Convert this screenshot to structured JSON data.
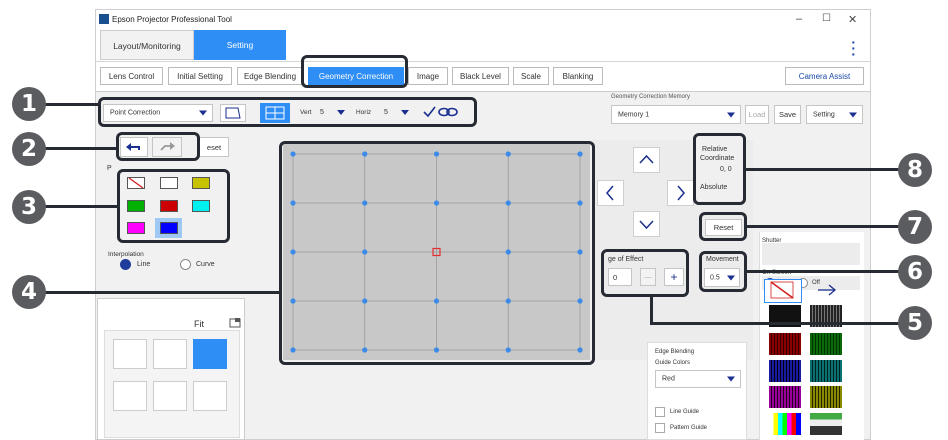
{
  "window": {
    "title": "Epson Projector Professional Tool"
  },
  "main_tabs": [
    {
      "label": "Layout/Monitoring"
    },
    {
      "label": "Setting"
    }
  ],
  "sub_tabs": [
    {
      "label": "Lens Control"
    },
    {
      "label": "Initial Setting"
    },
    {
      "label": "Edge Blending"
    },
    {
      "label": "Geometry Correction"
    },
    {
      "label": "Image"
    },
    {
      "label": "Black Level"
    },
    {
      "label": "Scale"
    },
    {
      "label": "Blanking"
    }
  ],
  "camera_assist_label": "Camera Assist",
  "correction_toolbar": {
    "mode_value": "Point Correction",
    "vert_label": "Vert",
    "vert_value": "5",
    "horiz_label": "Horiz",
    "horiz_value": "5"
  },
  "memory": {
    "label": "Geometry Correction Memory",
    "value": "Memory 1",
    "load_label": "Load",
    "save_label": "Save",
    "setting_label": "Setting"
  },
  "undo_panel": {
    "reset_label": "eset"
  },
  "palette_label": "P",
  "pattern_colors": [
    "#ffffff",
    "#ffffff",
    "#c8c300",
    "#00b000",
    "#cc0000",
    "#00f0f0",
    "#ff00ff",
    "#0000ff"
  ],
  "interpolation": {
    "label": "Interpolation",
    "line_label": "Line",
    "curve_label": "Curve"
  },
  "preview": {
    "fit_label": "Fit"
  },
  "range_of_effect": {
    "label": "ge of Effect",
    "value": "0",
    "minus": "—",
    "plus": "+"
  },
  "coordinates": {
    "relative_line1": "Relative",
    "relative_line2": "Coordinate",
    "value": "0, 0",
    "absolute_label": "Absolute"
  },
  "point_reset_label": "Reset",
  "movement": {
    "label": "Movement",
    "value": "0.5"
  },
  "shutter": {
    "label": "Shutter"
  },
  "on_screen": {
    "label": "On-Screen",
    "on_label": "On",
    "off_label": "Off"
  },
  "edge_blending_panel": {
    "title_line1": "Edge Blending",
    "title_line2": "Guide Colors",
    "color_value": "Red",
    "line_guide_label": "Line Guide",
    "pattern_guide_label": "Pattern Guide"
  },
  "callouts": [
    "1",
    "2",
    "3",
    "4",
    "5",
    "6",
    "7",
    "8"
  ],
  "grid": {
    "rows": 5,
    "cols": 5
  }
}
